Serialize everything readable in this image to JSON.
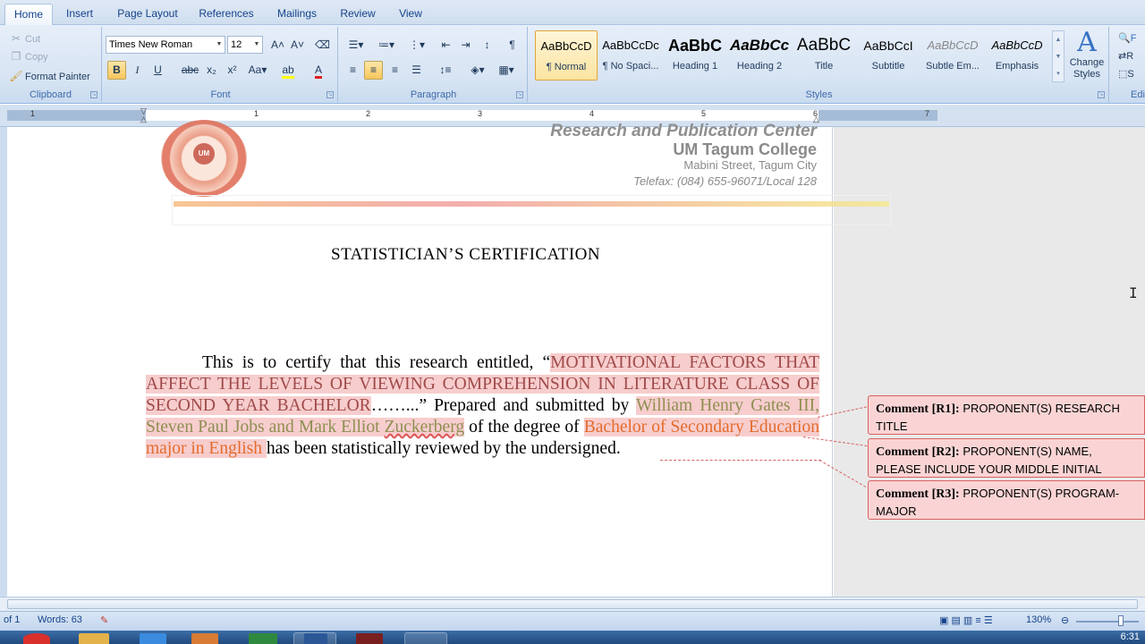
{
  "tabs": [
    "Home",
    "Insert",
    "Page Layout",
    "References",
    "Mailings",
    "Review",
    "View"
  ],
  "clipboard": {
    "cut": "Cut",
    "copy": "Copy",
    "format_painter": "Format Painter",
    "label": "Clipboard"
  },
  "font": {
    "name": "Times New Roman",
    "size": "12",
    "label": "Font"
  },
  "paragraph": {
    "label": "Paragraph"
  },
  "styles": {
    "label": "Styles",
    "items": [
      {
        "preview": "AaBbCcD",
        "name": "¶ Normal"
      },
      {
        "preview": "AaBbCcDc",
        "name": "¶ No Spaci..."
      },
      {
        "preview": "AaBbC",
        "name": "Heading 1"
      },
      {
        "preview": "AaBbCc",
        "name": "Heading 2"
      },
      {
        "preview": "AaBbC",
        "name": "Title"
      },
      {
        "preview": "AaBbCcI",
        "name": "Subtitle"
      },
      {
        "preview": "AaBbCcD",
        "name": "Subtle Em..."
      },
      {
        "preview": "AaBbCcD",
        "name": "Emphasis"
      }
    ],
    "change_styles": "Change Styles",
    "editing_label": "Edi"
  },
  "ruler_numbers": [
    "1",
    "1",
    "2",
    "3",
    "4",
    "5",
    "6",
    "7"
  ],
  "document": {
    "header": {
      "line1": "Research and Publication Center",
      "line2": "UM Tagum College",
      "line3": "Mabini Street, Tagum City",
      "line4": "Telefax: (084) 655-96071/Local 128",
      "logo_text": "UM TAGUM COLLEGE"
    },
    "title": "STATISTICIAN’S  CERTIFICATION",
    "body": {
      "p1": "This is to certify that this research entitled, “",
      "research_title": "MOTIVATIONAL FACTORS THAT AFFECT THE LEVELS OF VIEWING COMPREHENSION IN LITERATURE CLASS OF SECOND YEAR BACHELOR",
      "p2": "……...” Prepared and submitted by ",
      "names_a": "William Henry Gates III, Steven Paul Jobs and Mark Elliot ",
      "names_b": "Zuckerberg",
      "p3": " of the degree of ",
      "program": "Bachelor of Secondary Education major in English ",
      "p4": "has been statistically reviewed by the undersigned."
    },
    "comments": [
      {
        "id": "Comment [R1]:",
        "text": " PROPONENT(S) RESEARCH TITLE"
      },
      {
        "id": "Comment [R2]:",
        "text": " PROPONENT(S) NAME, PLEASE INCLUDE YOUR MIDDLE INITIAL"
      },
      {
        "id": "Comment [R3]:",
        "text": " PROPONENT(S) PROGRAM-MAJOR"
      }
    ]
  },
  "status": {
    "page": "of 1",
    "words": "Words: 63",
    "zoom": "130%"
  },
  "clock": "6:31",
  "colors": {
    "ribbon_bg": "#dbe6f4",
    "highlight_bg": "#f7cdcd",
    "title_text": "#a14a4a",
    "names_text": "#8e8f52",
    "program_text": "#e36c2d",
    "comment_border": "#d86161"
  }
}
